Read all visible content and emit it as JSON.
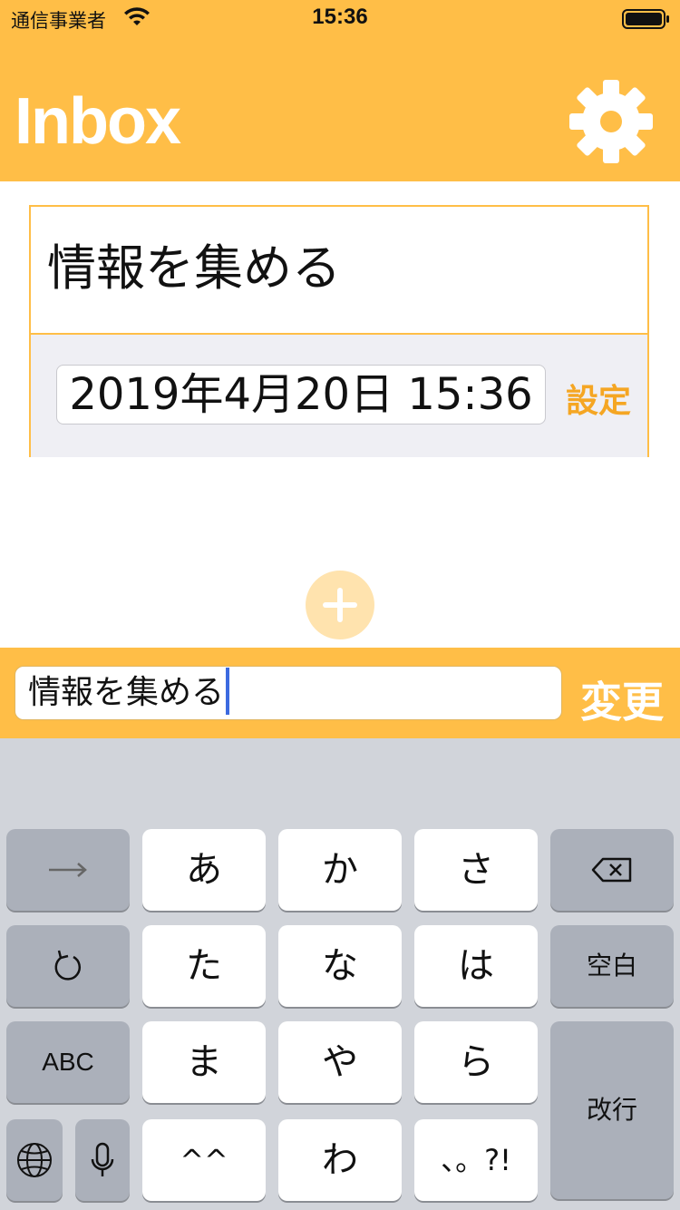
{
  "status_bar": {
    "carrier": "通信事業者",
    "time": "15:36"
  },
  "nav": {
    "title": "Inbox",
    "settings_icon": "gear-icon"
  },
  "task": {
    "title": "情報を集める",
    "date_value": "2019年4月20日 15:36",
    "set_label": "設定"
  },
  "add_button": {
    "icon": "plus-icon"
  },
  "input_bar": {
    "value": "情報を集める",
    "change_label": "変更"
  },
  "keyboard": {
    "keys": {
      "a": "あ",
      "ka": "か",
      "sa": "さ",
      "ta": "た",
      "na": "な",
      "ha": "は",
      "ma": "ま",
      "ya": "や",
      "ra": "ら",
      "kaomoji": "^^",
      "wa": "わ",
      "punct": "、。?!",
      "space": "空白",
      "abc": "ABC",
      "return": "改行"
    },
    "icons": [
      "arrow-right-icon",
      "backspace-icon",
      "undo-icon",
      "globe-icon",
      "microphone-icon"
    ]
  },
  "colors": {
    "accent": "#FFBE47",
    "accent_text": "#F5A623",
    "add_button_bg": "#FFE3AE",
    "keyboard_bg": "#D1D4DA",
    "dark_key": "#ABB0BA"
  }
}
